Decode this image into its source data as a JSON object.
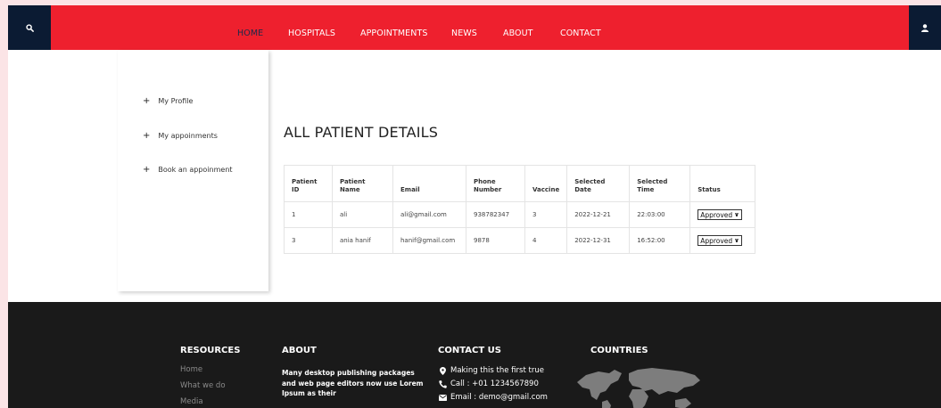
{
  "nav": {
    "items": [
      "HOME",
      "HOSPITALS",
      "APPOINTMENTS",
      "NEWS",
      "ABOUT",
      "CONTACT"
    ],
    "active": "HOME",
    "search_icon": "search-icon",
    "user_icon": "user-icon"
  },
  "sidebar": {
    "items": [
      "My Profile",
      "My appoinments",
      "Book an appoinment"
    ]
  },
  "main": {
    "title": "ALL PATIENT DETAILS",
    "table": {
      "headers": [
        "Patient ID",
        "Patient Name",
        "Email",
        "Phone Number",
        "Vaccine",
        "Selected Date",
        "Selected Time",
        "Status"
      ],
      "rows": [
        {
          "id": "1",
          "name": "ali",
          "email": "ali@gmail.com",
          "phone": "938782347",
          "vaccine": "3",
          "date": "2022-12-21",
          "time": "22:03:00",
          "status": "Approved"
        },
        {
          "id": "3",
          "name": "ania hanif",
          "email": "hanif@gmail.com",
          "phone": "9878",
          "vaccine": "4",
          "date": "2022-12-31",
          "time": "16:52:00",
          "status": "Approved"
        }
      ]
    }
  },
  "footer": {
    "resources": {
      "heading": "RESOURCES",
      "links": [
        "Home",
        "What we do",
        "Media"
      ]
    },
    "about": {
      "heading": "ABOUT",
      "text": "Many desktop publishing packages and web page editors now use Lorem Ipsum as their"
    },
    "contact": {
      "heading": "CONTACT US",
      "lines": [
        "Making this the first true",
        "Call : +01 1234567890",
        "Email : demo@gmail.com"
      ]
    },
    "countries": {
      "heading": "COUNTRIES"
    }
  },
  "colors": {
    "nav_bg": "#ee202e",
    "dark_box": "#0b1b33",
    "footer_bg": "#1a1a1a",
    "page_bg": "#fbe4e6"
  }
}
